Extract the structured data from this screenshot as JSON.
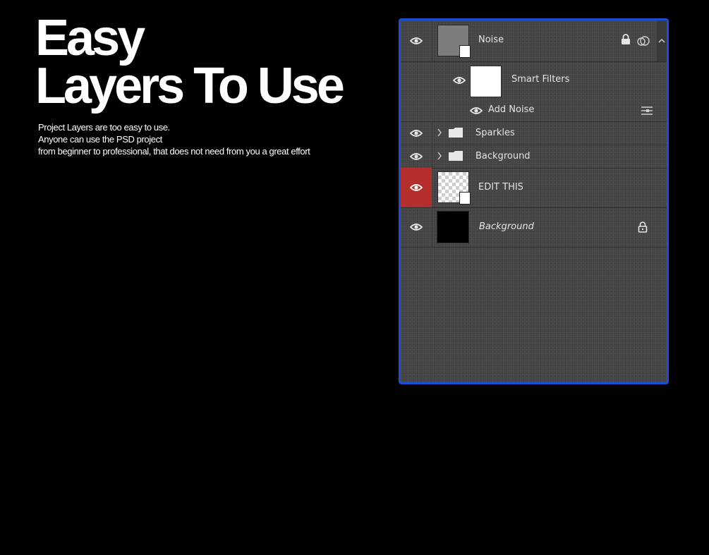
{
  "headline": {
    "line1": "Easy",
    "line2": "Layers To Use"
  },
  "description": {
    "line1": "Project Layers are too easy to use.",
    "line2": "Anyone can use the PSD project",
    "line3": "from beginner to professional, that does not need from you a great effort"
  },
  "layers_panel": {
    "border_color": "#1a4fd6",
    "selected_eye_color": "#b42f2b",
    "layers": [
      {
        "name": "Noise",
        "type": "smart-object",
        "icons": [
          "lock-icon",
          "link-icon",
          "chevron-up-icon"
        ]
      },
      {
        "name": "Smart Filters",
        "type": "smart-filters"
      },
      {
        "name": "Add Noise",
        "type": "filter",
        "icons": [
          "filter-options-icon"
        ]
      },
      {
        "name": "Sparkles",
        "type": "group"
      },
      {
        "name": "Background",
        "type": "group"
      },
      {
        "name": "EDIT THIS",
        "type": "smart-object",
        "selected": true
      },
      {
        "name": "Background",
        "type": "background",
        "icons": [
          "lock-icon"
        ]
      }
    ]
  }
}
